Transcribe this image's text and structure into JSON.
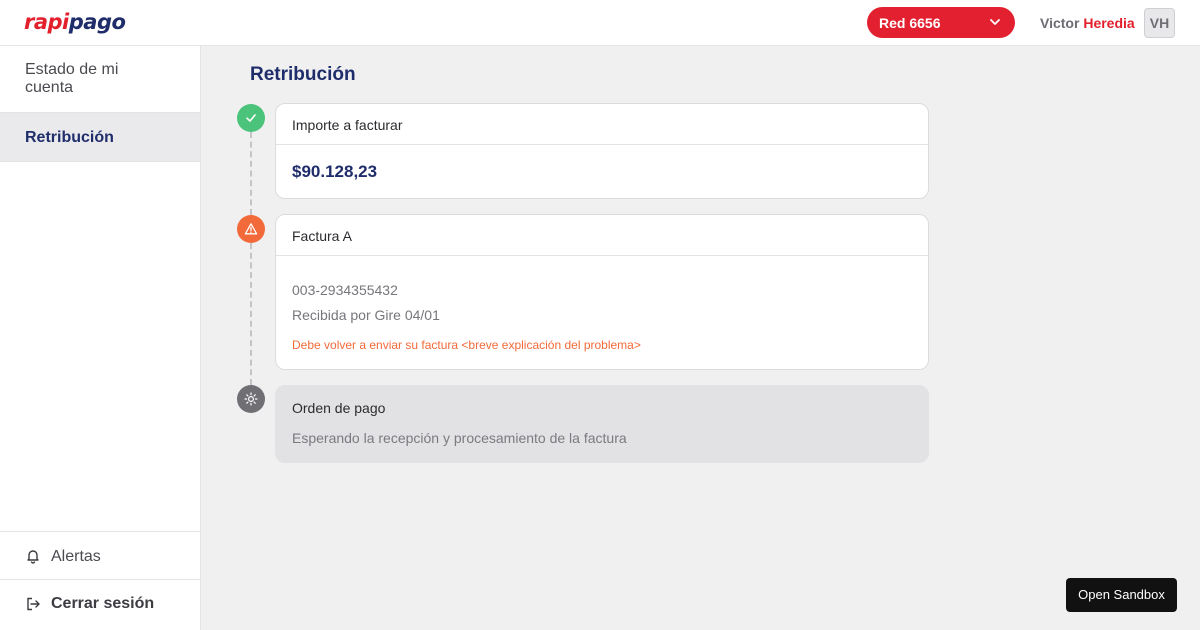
{
  "header": {
    "logo_part1": "rapi",
    "logo_part2": "pago",
    "account_selector": "Red 6656",
    "user_first_name": "Victor",
    "user_last_name": "Heredia",
    "avatar_initials": "VH"
  },
  "sidebar": {
    "items": [
      {
        "label": "Estado de mi cuenta",
        "active": false
      },
      {
        "label": "Retribución",
        "active": true
      }
    ],
    "bottom": [
      {
        "label": "Alertas",
        "icon": "bell-icon"
      },
      {
        "label": "Cerrar sesión",
        "icon": "logout-icon"
      }
    ]
  },
  "main": {
    "title": "Retribución",
    "steps": [
      {
        "status": "success",
        "icon": "check-icon",
        "title": "Importe a facturar",
        "amount": "$90.128,23"
      },
      {
        "status": "warning",
        "icon": "warning-icon",
        "title": "Factura A",
        "invoice_number": "003-2934355432",
        "received": "Recibida por Gire 04/01",
        "error": "Debe volver a enviar su factura <breve explicación del problema>"
      },
      {
        "status": "pending",
        "icon": "sun-icon",
        "title": "Orden de pago",
        "description": "Esperando la recepción y procesamiento de la factura"
      }
    ]
  },
  "sandbox_button": "Open Sandbox",
  "colors": {
    "brand_red": "#e21f2b",
    "brand_navy": "#1f2d6b",
    "success": "#4cc37a",
    "warning": "#f26a3a",
    "pending": "#6f6f74"
  }
}
